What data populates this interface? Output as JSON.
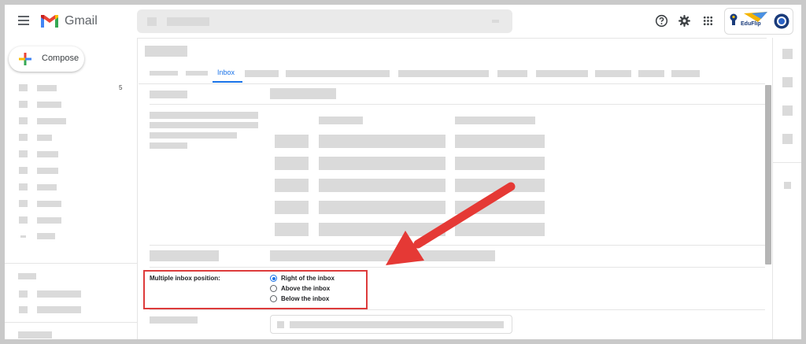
{
  "header": {
    "app_name": "Gmail",
    "menu_icon": "hamburger-menu-icon",
    "icons": [
      "help-icon",
      "settings-gear-icon",
      "apps-grid-icon"
    ],
    "account_brand": "EduFlip"
  },
  "sidebar": {
    "compose_label": "Compose",
    "inbox_count": "5"
  },
  "tabs": {
    "active_label": "Inbox"
  },
  "setting": {
    "label": "Multiple inbox position:",
    "options": [
      {
        "label": "Right of the inbox",
        "checked": true
      },
      {
        "label": "Above the inbox",
        "checked": false
      },
      {
        "label": "Below the inbox",
        "checked": false
      }
    ]
  },
  "colors": {
    "accent": "#1a73e8",
    "highlight": "#dd3b3b",
    "arrow": "#e53935"
  }
}
